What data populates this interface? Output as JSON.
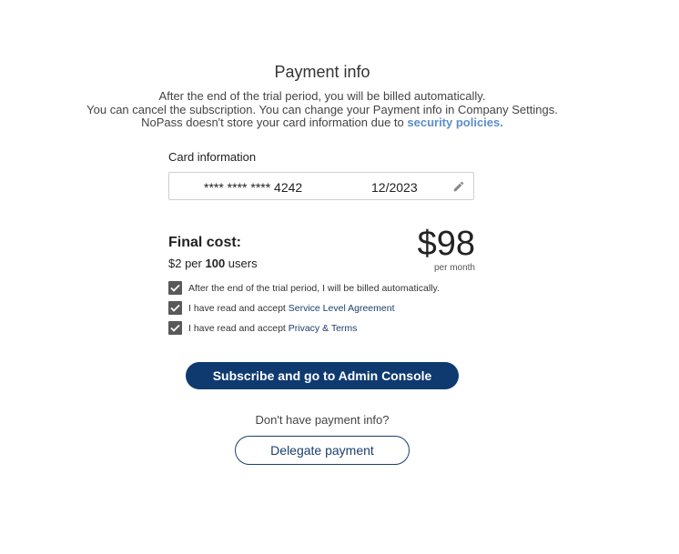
{
  "header": {
    "title": "Payment info",
    "intro_line1": "After the end of the trial period, you will be billed automatically.",
    "intro_line2": "You can cancel the subscription. You can change your Payment info in Company Settings.",
    "intro_line3_prefix": "NoPass doesn't store your card information due to ",
    "security_link": "security policies."
  },
  "card": {
    "label": "Card information",
    "number": "**** **** **** 4242",
    "expiry": "12/2023",
    "edit_icon": "pencil-icon"
  },
  "cost": {
    "label": "Final cost:",
    "rate_prefix": "$2 per ",
    "users_count": "100",
    "rate_suffix": " users",
    "price": "$98",
    "period": "per month"
  },
  "agreements": [
    {
      "checked": true,
      "text": "After the end of the trial period, I will be billed automatically.",
      "link": ""
    },
    {
      "checked": true,
      "text": "I have read and accept ",
      "link": "Service Level Agreement"
    },
    {
      "checked": true,
      "text": "I have read and accept ",
      "link": "Privacy & Terms"
    }
  ],
  "actions": {
    "subscribe_label": "Subscribe and go to Admin Console",
    "no_payment_text": "Don't have payment info?",
    "delegate_label": "Delegate payment"
  },
  "colors": {
    "primary": "#0f3a70",
    "link": "#5b8ec9",
    "checkbox": "#595959"
  }
}
